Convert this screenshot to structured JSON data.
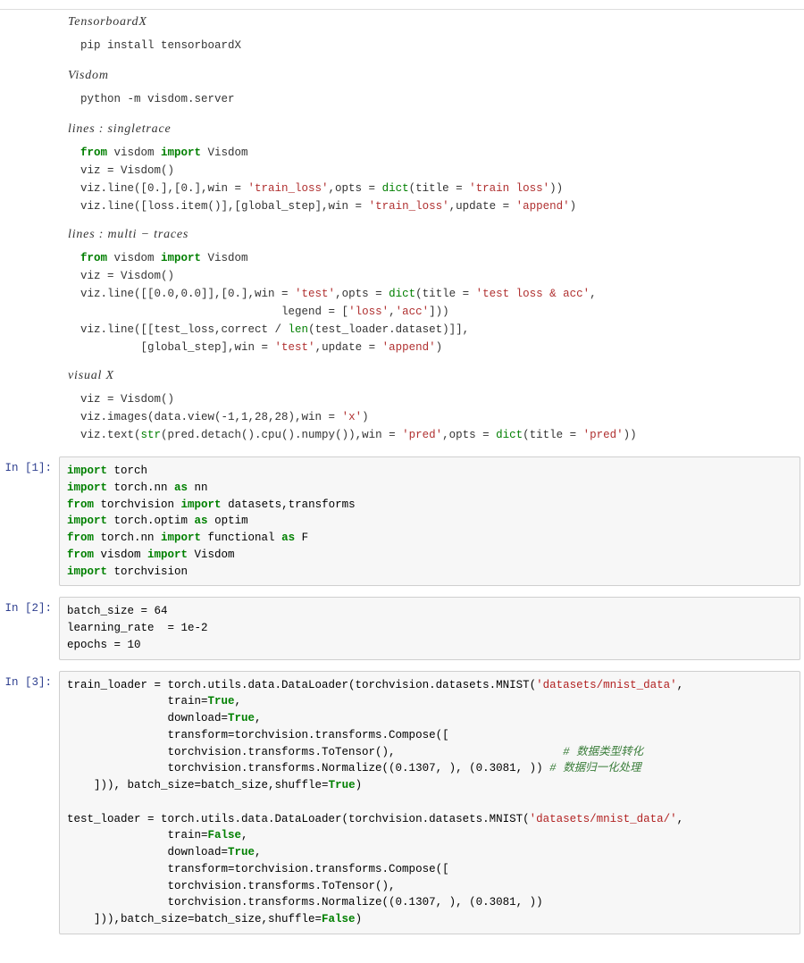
{
  "sections": {
    "tensorboardx": {
      "title": "TensorboardX",
      "code": "pip install tensorboardX"
    },
    "visdom": {
      "title": "Visdom",
      "code": "python -m visdom.server"
    },
    "single": {
      "title": "lines : singletrace"
    },
    "multi": {
      "title": "lines : multi − traces"
    },
    "visualx": {
      "title": "visual X"
    }
  },
  "md_code": {
    "single_l1a": "from",
    "single_l1b": " visdom ",
    "single_l1c": "import",
    "single_l1d": " Visdom",
    "single_l2": "viz = Visdom()",
    "single_l3a": "viz.line([0.],[0.],win = ",
    "single_l3b": "'train_loss'",
    "single_l3c": ",opts = ",
    "single_l3d": "dict",
    "single_l3e": "(title = ",
    "single_l3f": "'train loss'",
    "single_l3g": "))",
    "single_l4a": "viz.line([loss.item()],[global_step],win = ",
    "single_l4b": "'train_loss'",
    "single_l4c": ",update = ",
    "single_l4d": "'append'",
    "single_l4e": ")",
    "multi_l1a": "from",
    "multi_l1b": " visdom ",
    "multi_l1c": "import",
    "multi_l1d": " Visdom",
    "multi_l2": "viz = Visdom()",
    "multi_l3a": "viz.line([[0.0,0.0]],[0.],win = ",
    "multi_l3b": "'test'",
    "multi_l3c": ",opts = ",
    "multi_l3d": "dict",
    "multi_l3e": "(title = ",
    "multi_l3f": "'test loss & acc'",
    "multi_l3g": ",",
    "multi_l4a": "                              legend = [",
    "multi_l4b": "'loss'",
    "multi_l4c": ",",
    "multi_l4d": "'acc'",
    "multi_l4e": "]))",
    "multi_l5a": "viz.line([[test_loss,correct / ",
    "multi_l5b": "len",
    "multi_l5c": "(test_loader.dataset)]],",
    "multi_l6a": "         [global_step],win = ",
    "multi_l6b": "'test'",
    "multi_l6c": ",update = ",
    "multi_l6d": "'append'",
    "multi_l6e": ")",
    "vx_l1": "viz = Visdom()",
    "vx_l2a": "viz.images(data.view(-1,1,28,28),win = ",
    "vx_l2b": "'x'",
    "vx_l2c": ")",
    "vx_l3a": "viz.text(",
    "vx_l3b": "str",
    "vx_l3c": "(pred.detach().cpu().numpy()),win = ",
    "vx_l3d": "'pred'",
    "vx_l3e": ",opts = ",
    "vx_l3f": "dict",
    "vx_l3g": "(title = ",
    "vx_l3h": "'pred'",
    "vx_l3i": "))"
  },
  "cells": [
    {
      "prompt": "In  [1]:",
      "lines": [
        [
          {
            "t": "import",
            "c": "kw"
          },
          {
            "t": " torch"
          }
        ],
        [
          {
            "t": "import",
            "c": "kw"
          },
          {
            "t": " torch.nn "
          },
          {
            "t": "as",
            "c": "kw"
          },
          {
            "t": " nn"
          }
        ],
        [
          {
            "t": "from",
            "c": "kw"
          },
          {
            "t": " torchvision "
          },
          {
            "t": "import",
            "c": "kw"
          },
          {
            "t": " datasets,transforms"
          }
        ],
        [
          {
            "t": "import",
            "c": "kw"
          },
          {
            "t": " torch.optim "
          },
          {
            "t": "as",
            "c": "kw"
          },
          {
            "t": " optim"
          }
        ],
        [
          {
            "t": "from",
            "c": "kw"
          },
          {
            "t": " torch.nn "
          },
          {
            "t": "import",
            "c": "kw"
          },
          {
            "t": " functional "
          },
          {
            "t": "as",
            "c": "kw"
          },
          {
            "t": " F"
          }
        ],
        [
          {
            "t": "from",
            "c": "kw"
          },
          {
            "t": " visdom "
          },
          {
            "t": "import",
            "c": "kw"
          },
          {
            "t": " Visdom"
          }
        ],
        [
          {
            "t": "import",
            "c": "kw"
          },
          {
            "t": " torchvision"
          }
        ]
      ]
    },
    {
      "prompt": "In  [2]:",
      "lines": [
        [
          {
            "t": "batch_size = 64"
          }
        ],
        [
          {
            "t": "learning_rate  = 1e-2"
          }
        ],
        [
          {
            "t": "epochs = 10"
          }
        ]
      ]
    },
    {
      "prompt": "In  [3]:",
      "lines": [
        [
          {
            "t": "train_loader = torch.utils.data.DataLoader(torchvision.datasets.MNIST("
          },
          {
            "t": "'datasets/mnist_data'",
            "c": "str"
          },
          {
            "t": ","
          }
        ],
        [
          {
            "t": "               train="
          },
          {
            "t": "True",
            "c": "bool"
          },
          {
            "t": ","
          }
        ],
        [
          {
            "t": "               download="
          },
          {
            "t": "True",
            "c": "bool"
          },
          {
            "t": ","
          }
        ],
        [
          {
            "t": "               transform=torchvision.transforms.Compose(["
          }
        ],
        [
          {
            "t": "               torchvision.transforms.ToTensor(),                         "
          },
          {
            "t": "# 数据类型转化",
            "c": "cmt"
          }
        ],
        [
          {
            "t": "               torchvision.transforms.Normalize((0.1307, ), (0.3081, )) "
          },
          {
            "t": "# 数据归一化处理",
            "c": "cmt"
          }
        ],
        [
          {
            "t": "    ])), batch_size=batch_size,shuffle="
          },
          {
            "t": "True",
            "c": "bool"
          },
          {
            "t": ")"
          }
        ],
        [
          {
            "t": ""
          }
        ],
        [
          {
            "t": "test_loader = torch.utils.data.DataLoader(torchvision.datasets.MNIST("
          },
          {
            "t": "'datasets/mnist_data/'",
            "c": "str"
          },
          {
            "t": ","
          }
        ],
        [
          {
            "t": "               train="
          },
          {
            "t": "False",
            "c": "bool"
          },
          {
            "t": ","
          }
        ],
        [
          {
            "t": "               download="
          },
          {
            "t": "True",
            "c": "bool"
          },
          {
            "t": ","
          }
        ],
        [
          {
            "t": "               transform=torchvision.transforms.Compose(["
          }
        ],
        [
          {
            "t": "               torchvision.transforms.ToTensor(),"
          }
        ],
        [
          {
            "t": "               torchvision.transforms.Normalize((0.1307, ), (0.3081, ))"
          }
        ],
        [
          {
            "t": "    ])),batch_size=batch_size,shuffle="
          },
          {
            "t": "False",
            "c": "bool"
          },
          {
            "t": ")"
          }
        ]
      ]
    }
  ]
}
